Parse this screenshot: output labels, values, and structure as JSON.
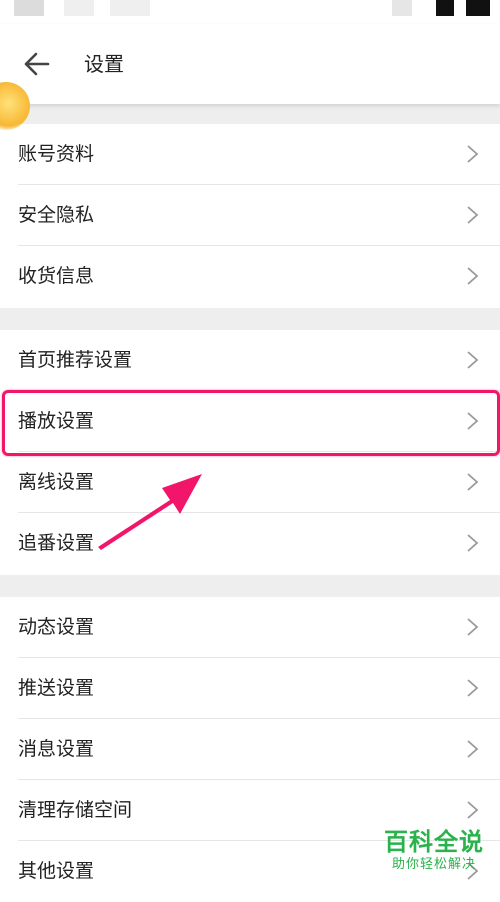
{
  "header": {
    "title": "设置"
  },
  "groups": [
    {
      "items": [
        {
          "label": "账号资料"
        },
        {
          "label": "安全隐私"
        },
        {
          "label": "收货信息"
        }
      ]
    },
    {
      "items": [
        {
          "label": "首页推荐设置"
        },
        {
          "label": "播放设置"
        },
        {
          "label": "离线设置"
        },
        {
          "label": "追番设置"
        }
      ]
    },
    {
      "items": [
        {
          "label": "动态设置"
        },
        {
          "label": "推送设置"
        },
        {
          "label": "消息设置"
        },
        {
          "label": "清理存储空间"
        },
        {
          "label": "其他设置"
        }
      ]
    }
  ],
  "annotation": {
    "highlighted_item": "播放设置",
    "color": "#f2166a"
  },
  "watermark": {
    "title": "百科全说",
    "subtitle": "助你轻松解决",
    "color": "#2bb24c"
  }
}
